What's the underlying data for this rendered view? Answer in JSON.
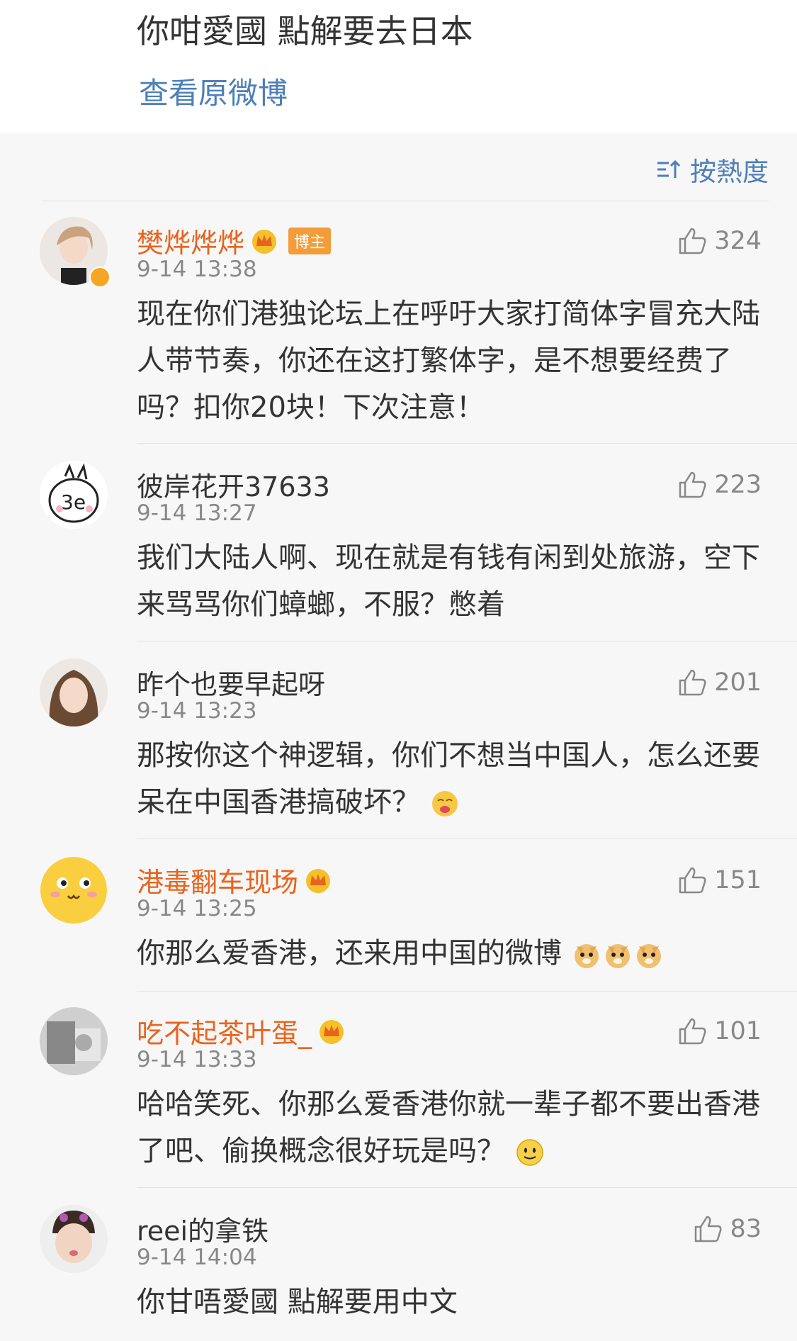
{
  "post": {
    "text": "你咁愛國 點解要去日本",
    "view_original": "查看原微博"
  },
  "sort": {
    "label": "按熱度",
    "icon": "sort-icon"
  },
  "comments": [
    {
      "name": "樊烨烨烨",
      "vip": true,
      "badge": "博主",
      "time": "9-14 13:38",
      "likes": "324",
      "text": "现在你们港独论坛上在呼吁大家打简体字冒充大陆人带节奏，你还在这打繁体字，是不想要经费了吗？扣你20块！下次注意！"
    },
    {
      "name": "彼岸花开37633",
      "vip": false,
      "badge": "",
      "time": "9-14 13:27",
      "likes": "223",
      "text": "我们大陆人啊、现在就是有钱有闲到处旅游，空下来骂骂你们蟑螂，不服？憋着"
    },
    {
      "name": "昨个也要早起呀",
      "vip": false,
      "badge": "",
      "time": "9-14 13:23",
      "likes": "201",
      "text": "那按你这个神逻辑，你们不想当中国人，怎么还要呆在中国香港搞破坏？"
    },
    {
      "name": "港毒翻车现场",
      "vip": true,
      "badge": "",
      "time": "9-14 13:25",
      "likes": "151",
      "text": "你那么爱香港，还来用中国的微博"
    },
    {
      "name": "吃不起茶叶蛋_",
      "vip": true,
      "badge": "",
      "time": "9-14 13:33",
      "likes": "101",
      "text": "哈哈笑死、你那么爱香港你就一辈子都不要出香港了吧、偷换概念很好玩是吗？"
    },
    {
      "name": "reei的拿铁",
      "vip": false,
      "badge": "",
      "time": "9-14 14:04",
      "likes": "83",
      "text": "你甘唔愛國 點解要用中文"
    }
  ],
  "colors": {
    "link": "#4d7fb8",
    "vip_name": "#e8641e",
    "badge": "#f39d3a"
  }
}
